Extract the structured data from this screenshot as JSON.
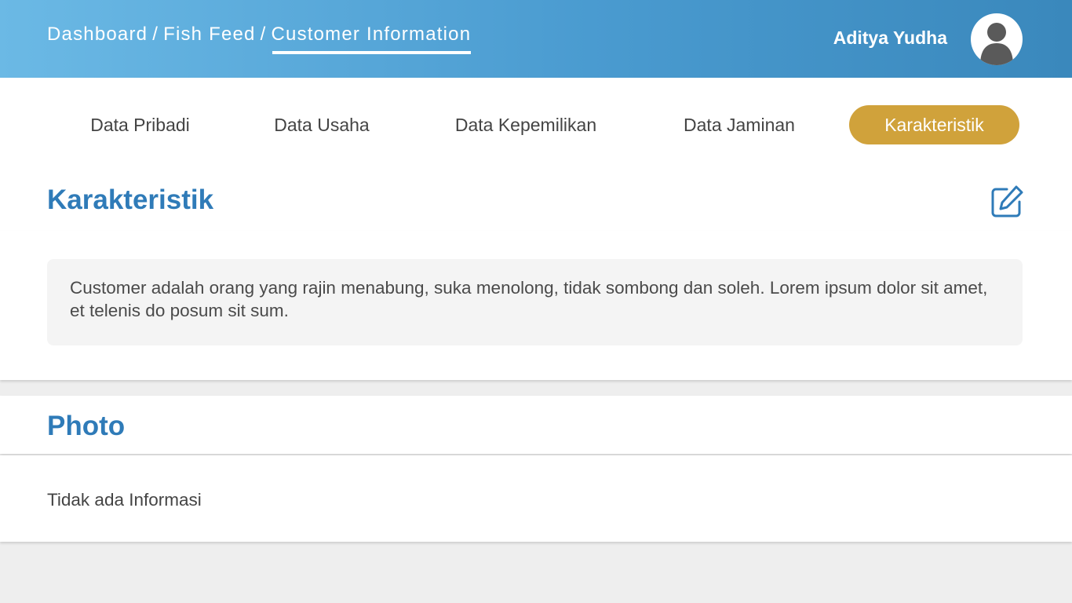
{
  "header": {
    "breadcrumb": [
      "Dashboard",
      "Fish Feed",
      "Customer Information"
    ],
    "separator": "/",
    "user_name": "Aditya Yudha",
    "avatar_icon": "user-avatar-icon"
  },
  "tabs": [
    {
      "label": "Data Pribadi",
      "active": false
    },
    {
      "label": "Data Usaha",
      "active": false
    },
    {
      "label": "Data Kepemilikan",
      "active": false
    },
    {
      "label": "Data Jaminan",
      "active": false
    },
    {
      "label": "Karakteristik",
      "active": true
    }
  ],
  "karakteristik": {
    "title": "Karakteristik",
    "edit_icon": "edit-icon",
    "description": "Customer adalah orang yang rajin menabung, suka menolong, tidak sombong dan soleh. Lorem ipsum dolor sit amet, et telenis do posum sit sum."
  },
  "photo": {
    "title": "Photo",
    "empty_text": "Tidak ada Informasi"
  },
  "colors": {
    "header_start": "#6bb9e5",
    "header_end": "#3a88bc",
    "accent_blue": "#2f7bb8",
    "active_tab": "#d0a23b"
  }
}
